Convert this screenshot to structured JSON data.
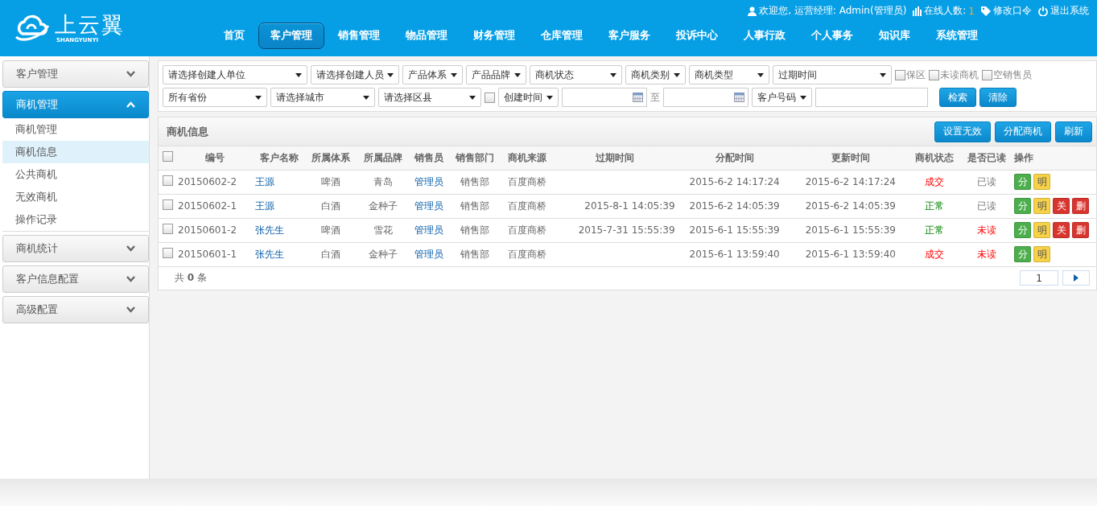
{
  "logo": {
    "name": "上云翼",
    "subtitle": "SHANGYUNYI"
  },
  "user_bar": {
    "welcome": "欢迎您, 运营经理: Admin(管理员)",
    "online_label": "在线人数:",
    "online_count": "1",
    "change_password": "修改口令",
    "logout": "退出系统"
  },
  "nav": [
    {
      "label": "首页",
      "selected": false
    },
    {
      "label": "客户管理",
      "selected": true
    },
    {
      "label": "销售管理",
      "selected": false
    },
    {
      "label": "物品管理",
      "selected": false
    },
    {
      "label": "财务管理",
      "selected": false
    },
    {
      "label": "仓库管理",
      "selected": false
    },
    {
      "label": "客户服务",
      "selected": false
    },
    {
      "label": "投诉中心",
      "selected": false
    },
    {
      "label": "人事行政",
      "selected": false
    },
    {
      "label": "个人事务",
      "selected": false
    },
    {
      "label": "知识库",
      "selected": false
    },
    {
      "label": "系统管理",
      "selected": false
    }
  ],
  "sidebar": [
    {
      "label": "客户管理",
      "expanded": false
    },
    {
      "label": "商机管理",
      "expanded": true,
      "children": [
        {
          "label": "商机管理",
          "selected": false
        },
        {
          "label": "商机信息",
          "selected": true
        },
        {
          "label": "公共商机",
          "selected": false
        },
        {
          "label": "无效商机",
          "selected": false
        },
        {
          "label": "操作记录",
          "selected": false
        }
      ]
    },
    {
      "label": "商机统计",
      "expanded": false
    },
    {
      "label": "客户信息配置",
      "expanded": false
    },
    {
      "label": "高级配置",
      "expanded": false
    }
  ],
  "filters": {
    "row_1": [
      {
        "kind": "select",
        "value": "请选择创建人单位"
      },
      {
        "kind": "select",
        "value": "请选择创建人员"
      },
      {
        "kind": "select",
        "value": "产品体系"
      },
      {
        "kind": "select",
        "value": "产品品牌"
      },
      {
        "kind": "select",
        "value": "商机状态"
      },
      {
        "kind": "select",
        "value": "商机类别"
      },
      {
        "kind": "select",
        "value": "商机类型"
      },
      {
        "kind": "select",
        "value": "过期时间"
      },
      {
        "kind": "checkbox",
        "label": "保区",
        "checked": false
      },
      {
        "kind": "checkbox",
        "label": "未读商机",
        "checked": false
      },
      {
        "kind": "checkbox",
        "label": "空销售员",
        "checked": false
      }
    ],
    "row_2": [
      {
        "kind": "select",
        "value": "所有省份"
      },
      {
        "kind": "select",
        "value": "请选择城市"
      },
      {
        "kind": "select",
        "value": "请选择区县"
      },
      {
        "kind": "checkbox",
        "checked": false
      },
      {
        "kind": "select",
        "value": "创建时间"
      },
      {
        "kind": "date"
      },
      {
        "kind": "text",
        "label": "至"
      },
      {
        "kind": "date"
      },
      {
        "kind": "select",
        "value": "客户号码"
      },
      {
        "kind": "input"
      }
    ],
    "buttons": [
      "检索",
      "清除"
    ]
  },
  "grid": {
    "title": "商机信息",
    "select_all_checked": false,
    "buttons": [
      "设置无效",
      "分配商机",
      "刷新"
    ],
    "columns": [
      "编号",
      "客户名称",
      "所属体系",
      "所属品牌",
      "销售员",
      "销售部门",
      "商机来源",
      "过期时间",
      "分配时间",
      "更新时间",
      "商机状态",
      "是否已读",
      "操作"
    ],
    "rows": [
      {
        "checked": false,
        "id": "20150602-2",
        "customer": "王源",
        "system": "啤酒",
        "brand": "青岛",
        "sales": "管理员",
        "dept": "销售部",
        "source": "百度商桥",
        "expire": "",
        "assigned": "2015-6-2 14:17:24",
        "updated": "2015-6-2 14:17:24",
        "status": {
          "text": "成交",
          "kind": "deal"
        },
        "read": {
          "text": "已读",
          "unread": false
        },
        "actions": [
          {
            "label": "分",
            "kind": "assign"
          },
          {
            "label": "明",
            "kind": "detail"
          }
        ]
      },
      {
        "checked": false,
        "id": "20150602-1",
        "customer": "王源",
        "system": "白酒",
        "brand": "金种子",
        "sales": "管理员",
        "dept": "销售部",
        "source": "百度商桥",
        "expire": "2015-8-1 14:05:39",
        "assigned": "2015-6-2 14:05:39",
        "updated": "2015-6-2 14:05:39",
        "status": {
          "text": "正常",
          "kind": "normal"
        },
        "read": {
          "text": "已读",
          "unread": false
        },
        "actions": [
          {
            "label": "分",
            "kind": "assign"
          },
          {
            "label": "明",
            "kind": "detail"
          },
          {
            "label": "关",
            "kind": "close"
          },
          {
            "label": "删",
            "kind": "delete"
          }
        ]
      },
      {
        "checked": false,
        "id": "20150601-2",
        "customer": "张先生",
        "system": "啤酒",
        "brand": "雪花",
        "sales": "管理员",
        "dept": "销售部",
        "source": "百度商桥",
        "expire": "2015-7-31 15:55:39",
        "assigned": "2015-6-1 15:55:39",
        "updated": "2015-6-1 15:55:39",
        "status": {
          "text": "正常",
          "kind": "normal"
        },
        "read": {
          "text": "未读",
          "unread": true
        },
        "actions": [
          {
            "label": "分",
            "kind": "assign"
          },
          {
            "label": "明",
            "kind": "detail"
          },
          {
            "label": "关",
            "kind": "close"
          },
          {
            "label": "删",
            "kind": "delete"
          }
        ]
      },
      {
        "checked": false,
        "id": "20150601-1",
        "customer": "张先生",
        "system": "白酒",
        "brand": "金种子",
        "sales": "管理员",
        "dept": "销售部",
        "source": "百度商桥",
        "expire": "",
        "assigned": "2015-6-1 13:59:40",
        "updated": "2015-6-1 13:59:40",
        "status": {
          "text": "成交",
          "kind": "deal"
        },
        "read": {
          "text": "未读",
          "unread": true
        },
        "actions": [
          {
            "label": "分",
            "kind": "assign"
          },
          {
            "label": "明",
            "kind": "detail"
          }
        ]
      }
    ],
    "total": "共 **0** 条",
    "page": "1"
  }
}
